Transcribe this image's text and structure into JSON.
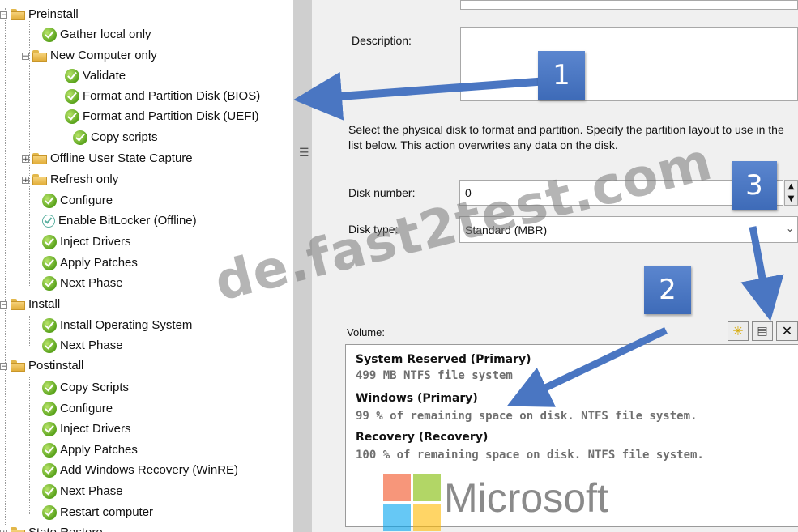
{
  "tree": {
    "items": [
      {
        "label": "Preinstall",
        "type": "folder"
      },
      {
        "label": "Gather local only",
        "type": "step"
      },
      {
        "label": "New Computer only",
        "type": "folder"
      },
      {
        "label": "Validate",
        "type": "step"
      },
      {
        "label": "Format and Partition Disk (BIOS)",
        "type": "step",
        "selected": true
      },
      {
        "label": "Format and Partition Disk (UEFI)",
        "type": "step"
      },
      {
        "label": "Copy scripts",
        "type": "step"
      },
      {
        "label": "Offline User State Capture",
        "type": "folder"
      },
      {
        "label": "Refresh only",
        "type": "folder"
      },
      {
        "label": "Configure",
        "type": "step"
      },
      {
        "label": "Enable BitLocker (Offline)",
        "type": "step-disabled"
      },
      {
        "label": "Inject Drivers",
        "type": "step"
      },
      {
        "label": "Apply Patches",
        "type": "step"
      },
      {
        "label": "Next Phase",
        "type": "step"
      },
      {
        "label": "Install",
        "type": "folder"
      },
      {
        "label": "Install Operating System",
        "type": "step"
      },
      {
        "label": "Next Phase",
        "type": "step"
      },
      {
        "label": "Postinstall",
        "type": "folder"
      },
      {
        "label": "Copy Scripts",
        "type": "step"
      },
      {
        "label": "Configure",
        "type": "step"
      },
      {
        "label": "Inject Drivers",
        "type": "step"
      },
      {
        "label": "Apply Patches",
        "type": "step"
      },
      {
        "label": "Add Windows Recovery (WinRE)",
        "type": "step"
      },
      {
        "label": "Next Phase",
        "type": "step"
      },
      {
        "label": "Restart computer",
        "type": "step"
      },
      {
        "label": "State Restore",
        "type": "folder"
      }
    ]
  },
  "props": {
    "description_label": "Description:",
    "description_value": "",
    "instructions": "Select the physical disk to format and partition.  Specify the partition layout to use in the list below. This action overwrites any data on the disk.",
    "disk_number_label": "Disk number:",
    "disk_number_value": "0",
    "disk_type_label": "Disk type:",
    "disk_type_value": "Standard (MBR)",
    "volume_label": "Volume:",
    "volumes": [
      {
        "title": "System Reserved (Primary)",
        "desc": "499 MB NTFS file system"
      },
      {
        "title": "Windows (Primary)",
        "desc": "99 % of remaining space on disk. NTFS file system."
      },
      {
        "title": "Recovery (Recovery)",
        "desc": "100 % of remaining space on disk. NTFS file system."
      }
    ]
  },
  "toolbar_icons": [
    "new-icon",
    "properties-icon",
    "delete-icon"
  ],
  "callouts": [
    "1",
    "2",
    "3"
  ],
  "watermark": "de.fast2test.com",
  "logo_text": "Microsoft",
  "colors": {
    "callout": "#4a76c2",
    "check_green": "#5aa31c",
    "folder_yellow": "#e2ae3a",
    "panel_bg": "#f0f0f0"
  }
}
